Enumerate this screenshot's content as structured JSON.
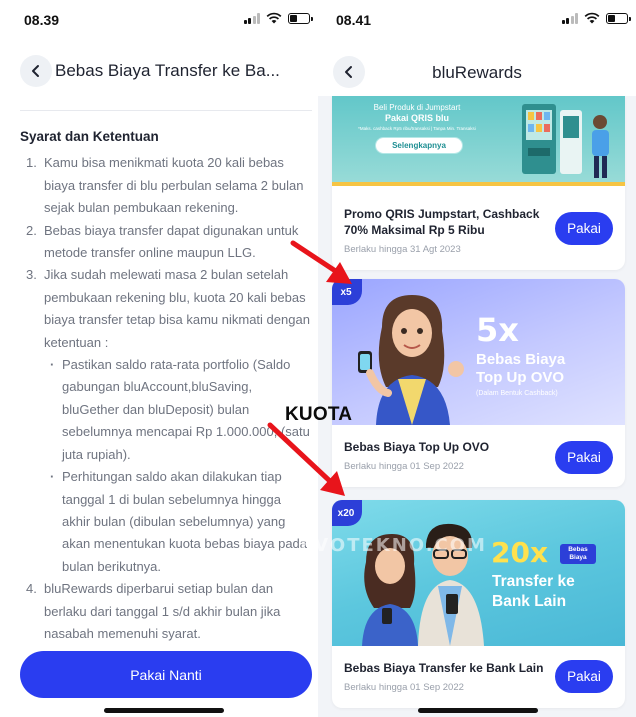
{
  "left": {
    "status_time": "08.39",
    "header_title": "Bebas Biaya Transfer ke Ba...",
    "terms_title": "Syarat dan Ketentuan",
    "terms": [
      {
        "n": "1.",
        "text": "Kamu bisa menikmati kuota 20 kali bebas biaya transfer di blu perbulan selama 2 bulan sejak bulan pembukaan rekening."
      },
      {
        "n": "2.",
        "text": "Bebas biaya transfer dapat digunakan untuk metode transfer online maupun LLG."
      },
      {
        "n": "3.",
        "text": "Jika sudah melewati masa 2 bulan setelah pembukaan rekening blu, kuota 20 kali bebas biaya transfer tetap bisa kamu nikmati dengan ketentuan :"
      },
      {
        "n": "4.",
        "text": "bluRewards diperbarui setiap bulan dan berlaku dari tanggal 1 s/d akhir bulan jika nasabah memenuhi syarat."
      }
    ],
    "sub_terms": [
      "Pastikan saldo rata-rata portfolio (Saldo gabungan bluAccount,bluSaving, bluGether dan bluDeposit) bulan sebelumnya mencapai Rp 1.000.000, (satu juta rupiah).",
      "Perhitungan saldo akan dilakukan tiap tanggal 1 di bulan sebelumnya hingga akhir bulan (dibulan sebelumnya) yang akan menentukan kuota bebas biaya pada bulan berikutnya."
    ],
    "button_label": "Pakai Nanti"
  },
  "right": {
    "status_time": "08.41",
    "header_title": "bluRewards",
    "banner1": {
      "line1": "Beli Produk di Jumpstart",
      "line2": "Pakai QRIS blu",
      "small": "*Maks. cashback Rp5 ribu/transaksi | Tanpa Min. Transaksi",
      "button": "Selengkapnya"
    },
    "cards": [
      {
        "badge": "",
        "title": "Promo QRIS Jumpstart, Cashback 70% Maksimal Rp 5 Ribu",
        "date": "Berlaku hingga 31 Agt 2023",
        "button": "Pakai"
      },
      {
        "badge": "x5",
        "title": "Bebas Biaya Top Up OVO",
        "date": "Berlaku hingga 01 Sep 2022",
        "button": "Pakai"
      },
      {
        "badge": "x20",
        "title": "Bebas Biaya Transfer ke Bank Lain",
        "date": "Berlaku hingga 01 Sep 2022",
        "button": "Pakai"
      }
    ],
    "banner2": {
      "big": "5x",
      "line1": "Bebas Biaya",
      "line2": "Top Up OVO",
      "line3": "(Dalam Bentuk Cashback)"
    },
    "banner3": {
      "big": "20x",
      "tag": "Bebas Biaya",
      "line1": "Transfer ke",
      "line2": "Bank Lain"
    }
  },
  "overlay": {
    "kuota_label": "KUOTA",
    "watermark": "EVOTEKNO.COM",
    "arrow_color": "#e8141b"
  },
  "colors": {
    "accent": "#2a3df0",
    "badge": "#2c3fd8",
    "arrow": "#e8141b"
  }
}
